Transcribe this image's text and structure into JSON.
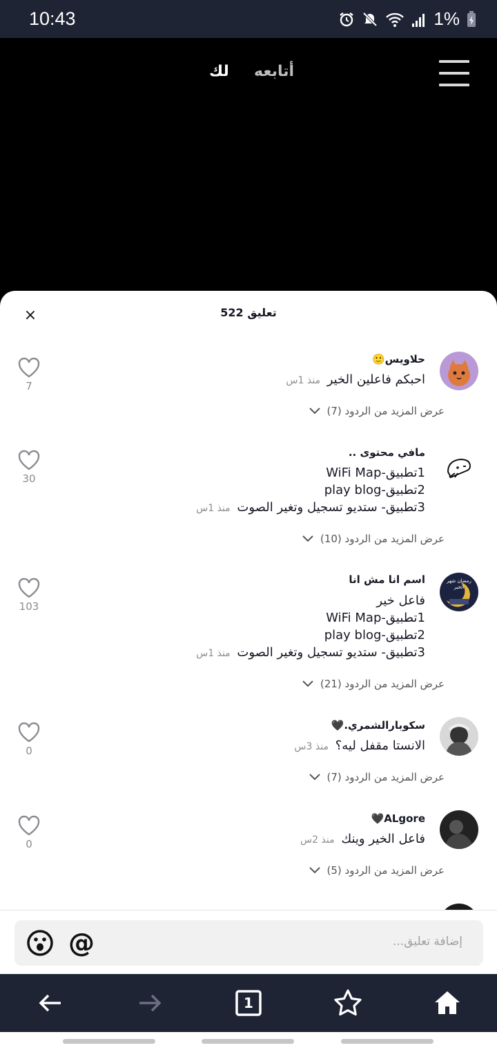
{
  "status": {
    "time": "10:43",
    "battery": "1%"
  },
  "nav": {
    "following": "أتابعه",
    "for_you": "لك"
  },
  "comments_sheet": {
    "count_label": "522 تعليق",
    "close_label": "×",
    "comments": [
      {
        "username": "حلاويس🙂",
        "lines": [
          "احبكم فاعلين الخير"
        ],
        "time": "منذ 1س",
        "likes": "7",
        "replies": "عرض المزيد من الردود (7)"
      },
      {
        "username": "مافي محتوى ..",
        "lines": [
          "1تطبيق-WiFi Map",
          "2تطبيق-play blog",
          "3تطبيق- ستديو تسجيل وتغير الصوت"
        ],
        "time": "منذ 1س",
        "likes": "30",
        "replies": "عرض المزيد من الردود (10)"
      },
      {
        "username": "اسم انا مش انا",
        "lines": [
          "فاعل خير",
          "1تطبيق-WiFi Map",
          "2تطبيق-play blog",
          "3تطبيق- ستديو تسجيل وتغير الصوت"
        ],
        "time": "منذ 1س",
        "likes": "103",
        "replies": "عرض المزيد من الردود (21)"
      },
      {
        "username": "سكوبارالشمري.🖤",
        "lines": [
          "الانستا مقفل ليه؟"
        ],
        "time": "منذ 3س",
        "likes": "0",
        "replies": "عرض المزيد من الردود (7)"
      },
      {
        "username": "ALgore🖤",
        "lines": [
          "فاعل الخير وينك"
        ],
        "time": "منذ 2س",
        "likes": "0",
        "replies": "عرض المزيد من الردود (5)"
      }
    ],
    "avatar3_text": "رمضان شهر الخير"
  },
  "input": {
    "placeholder": "إضافة تعليق..."
  },
  "browser": {
    "tab_count": "1"
  },
  "colors": {
    "dark_bar": "#1f2434",
    "sheet_bg": "#ffffff",
    "muted": "#8a8b91"
  }
}
